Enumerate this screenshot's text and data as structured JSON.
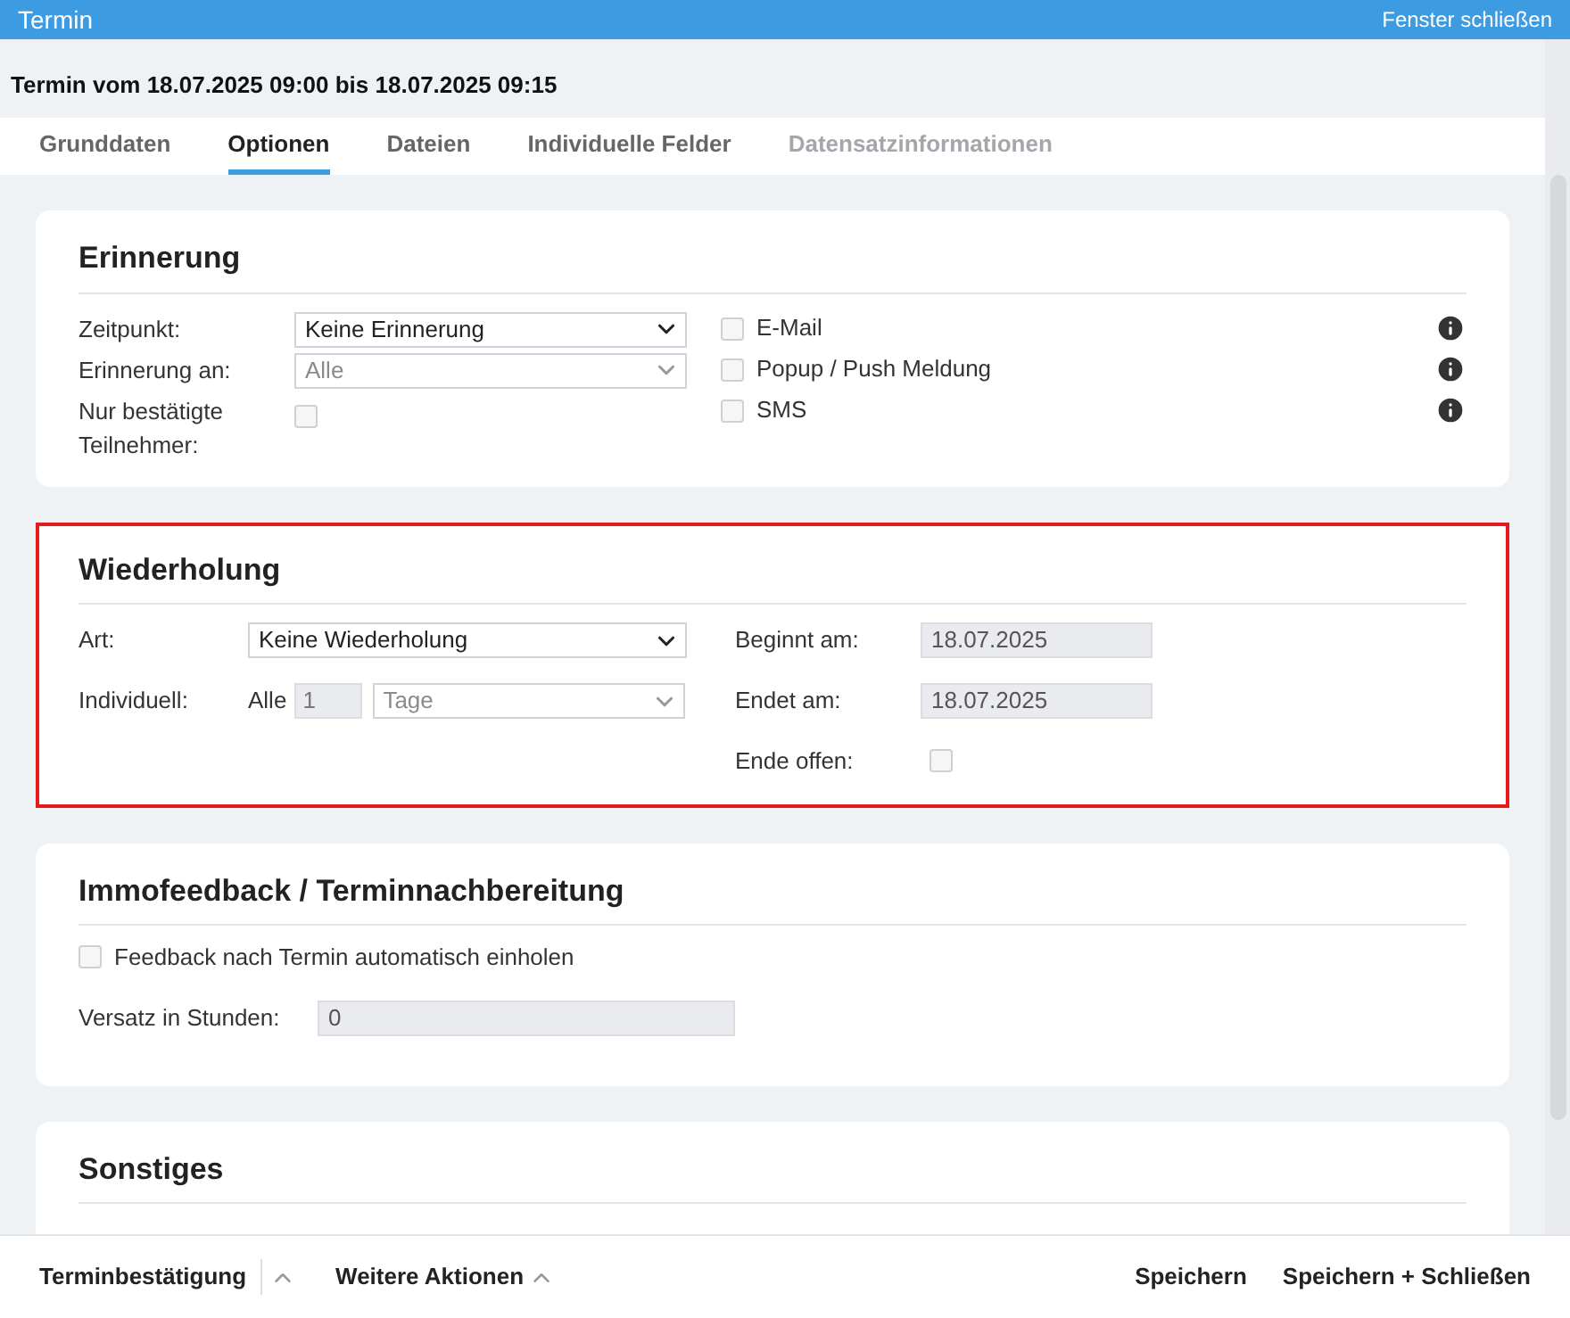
{
  "window": {
    "title": "Termin",
    "close_link": "Fenster schließen"
  },
  "heading": "Termin vom 18.07.2025 09:00 bis 18.07.2025 09:15",
  "tabs": [
    {
      "label": "Grunddaten",
      "selected": false,
      "disabled": false
    },
    {
      "label": "Optionen",
      "selected": true,
      "disabled": false
    },
    {
      "label": "Dateien",
      "selected": false,
      "disabled": false
    },
    {
      "label": "Individuelle Felder",
      "selected": false,
      "disabled": false
    },
    {
      "label": "Datensatzinformationen",
      "selected": false,
      "disabled": true
    }
  ],
  "reminder": {
    "title": "Erinnerung",
    "highlighted": false,
    "fields": [
      {
        "kind": "select",
        "label": "Zeitpunkt:",
        "value": "Keine Erinnerung",
        "disabled": false
      },
      {
        "kind": "select",
        "label": "Erinnerung an:",
        "value": "Alle",
        "disabled": true
      },
      {
        "kind": "checkbox",
        "label": "Nur bestätigte Teilnehmer:",
        "checked": false
      }
    ],
    "channels": [
      {
        "label": "E-Mail",
        "checked": false
      },
      {
        "label": "Popup / Push Meldung",
        "checked": false
      },
      {
        "label": "SMS",
        "checked": false
      }
    ]
  },
  "recurrence": {
    "title": "Wiederholung",
    "highlighted": true,
    "type": {
      "label": "Art:",
      "value": "Keine Wiederholung",
      "disabled": false
    },
    "custom": {
      "label": "Individuell:",
      "prefix": "Alle",
      "count": "1",
      "unit": "Tage",
      "disabled": true
    },
    "begins": {
      "label": "Beginnt am:",
      "value": "18.07.2025"
    },
    "ends": {
      "label": "Endet am:",
      "value": "18.07.2025"
    },
    "open_end": {
      "label": "Ende offen:",
      "checked": false
    }
  },
  "feedback": {
    "title": "Immofeedback / Terminnachbereitung",
    "highlighted": false,
    "auto": {
      "label": "Feedback nach Termin automatisch einholen",
      "checked": false
    },
    "offset": {
      "label": "Versatz in Stunden:",
      "value": "0"
    }
  },
  "other": {
    "title": "Sonstiges",
    "highlighted": false
  },
  "footer": {
    "left": [
      {
        "kind": "split",
        "label": "Terminbestätigung"
      },
      {
        "kind": "menu",
        "label": "Weitere Aktionen"
      }
    ],
    "right": [
      {
        "label": "Speichern"
      },
      {
        "label": "Speichern + Schließen"
      }
    ]
  }
}
